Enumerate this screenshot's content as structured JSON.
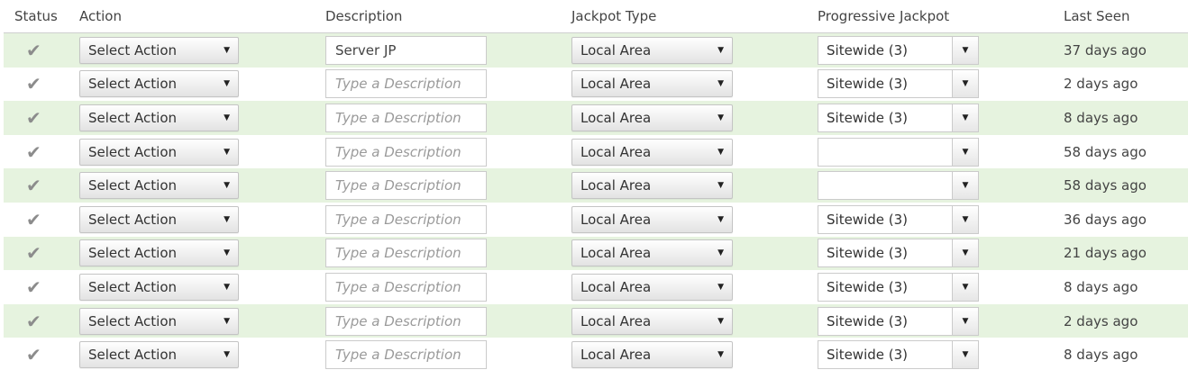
{
  "headers": {
    "status": "Status",
    "action": "Action",
    "description": "Description",
    "jackpot_type": "Jackpot Type",
    "progressive_jackpot": "Progressive Jackpot",
    "last_seen": "Last Seen"
  },
  "icons": {
    "status": "check-icon",
    "dropdown": "caret-down-icon"
  },
  "colors": {
    "alt_row": "#e6f3df",
    "check": "#8c8c8c"
  },
  "rows": [
    {
      "status": "✔",
      "action": "Select Action",
      "description": "Server JP",
      "description_placeholder": "Type a Description",
      "jackpot_type": "Local Area",
      "progressive": "Sitewide (3)",
      "last_seen": "37 days ago"
    },
    {
      "status": "✔",
      "action": "Select Action",
      "description": "",
      "description_placeholder": "Type a Description",
      "jackpot_type": "Local Area",
      "progressive": "Sitewide (3)",
      "last_seen": "2 days ago"
    },
    {
      "status": "✔",
      "action": "Select Action",
      "description": "",
      "description_placeholder": "Type a Description",
      "jackpot_type": "Local Area",
      "progressive": "Sitewide (3)",
      "last_seen": "8 days ago"
    },
    {
      "status": "✔",
      "action": "Select Action",
      "description": "",
      "description_placeholder": "Type a Description",
      "jackpot_type": "Local Area",
      "progressive": "",
      "last_seen": "58 days ago"
    },
    {
      "status": "✔",
      "action": "Select Action",
      "description": "",
      "description_placeholder": "Type a Description",
      "jackpot_type": "Local Area",
      "progressive": "",
      "last_seen": "58 days ago"
    },
    {
      "status": "✔",
      "action": "Select Action",
      "description": "",
      "description_placeholder": "Type a Description",
      "jackpot_type": "Local Area",
      "progressive": "Sitewide (3)",
      "last_seen": "36 days ago"
    },
    {
      "status": "✔",
      "action": "Select Action",
      "description": "",
      "description_placeholder": "Type a Description",
      "jackpot_type": "Local Area",
      "progressive": "Sitewide (3)",
      "last_seen": "21 days ago"
    },
    {
      "status": "✔",
      "action": "Select Action",
      "description": "",
      "description_placeholder": "Type a Description",
      "jackpot_type": "Local Area",
      "progressive": "Sitewide (3)",
      "last_seen": "8 days ago"
    },
    {
      "status": "✔",
      "action": "Select Action",
      "description": "",
      "description_placeholder": "Type a Description",
      "jackpot_type": "Local Area",
      "progressive": "Sitewide (3)",
      "last_seen": "2 days ago"
    },
    {
      "status": "✔",
      "action": "Select Action",
      "description": "",
      "description_placeholder": "Type a Description",
      "jackpot_type": "Local Area",
      "progressive": "Sitewide (3)",
      "last_seen": "8 days ago"
    }
  ]
}
